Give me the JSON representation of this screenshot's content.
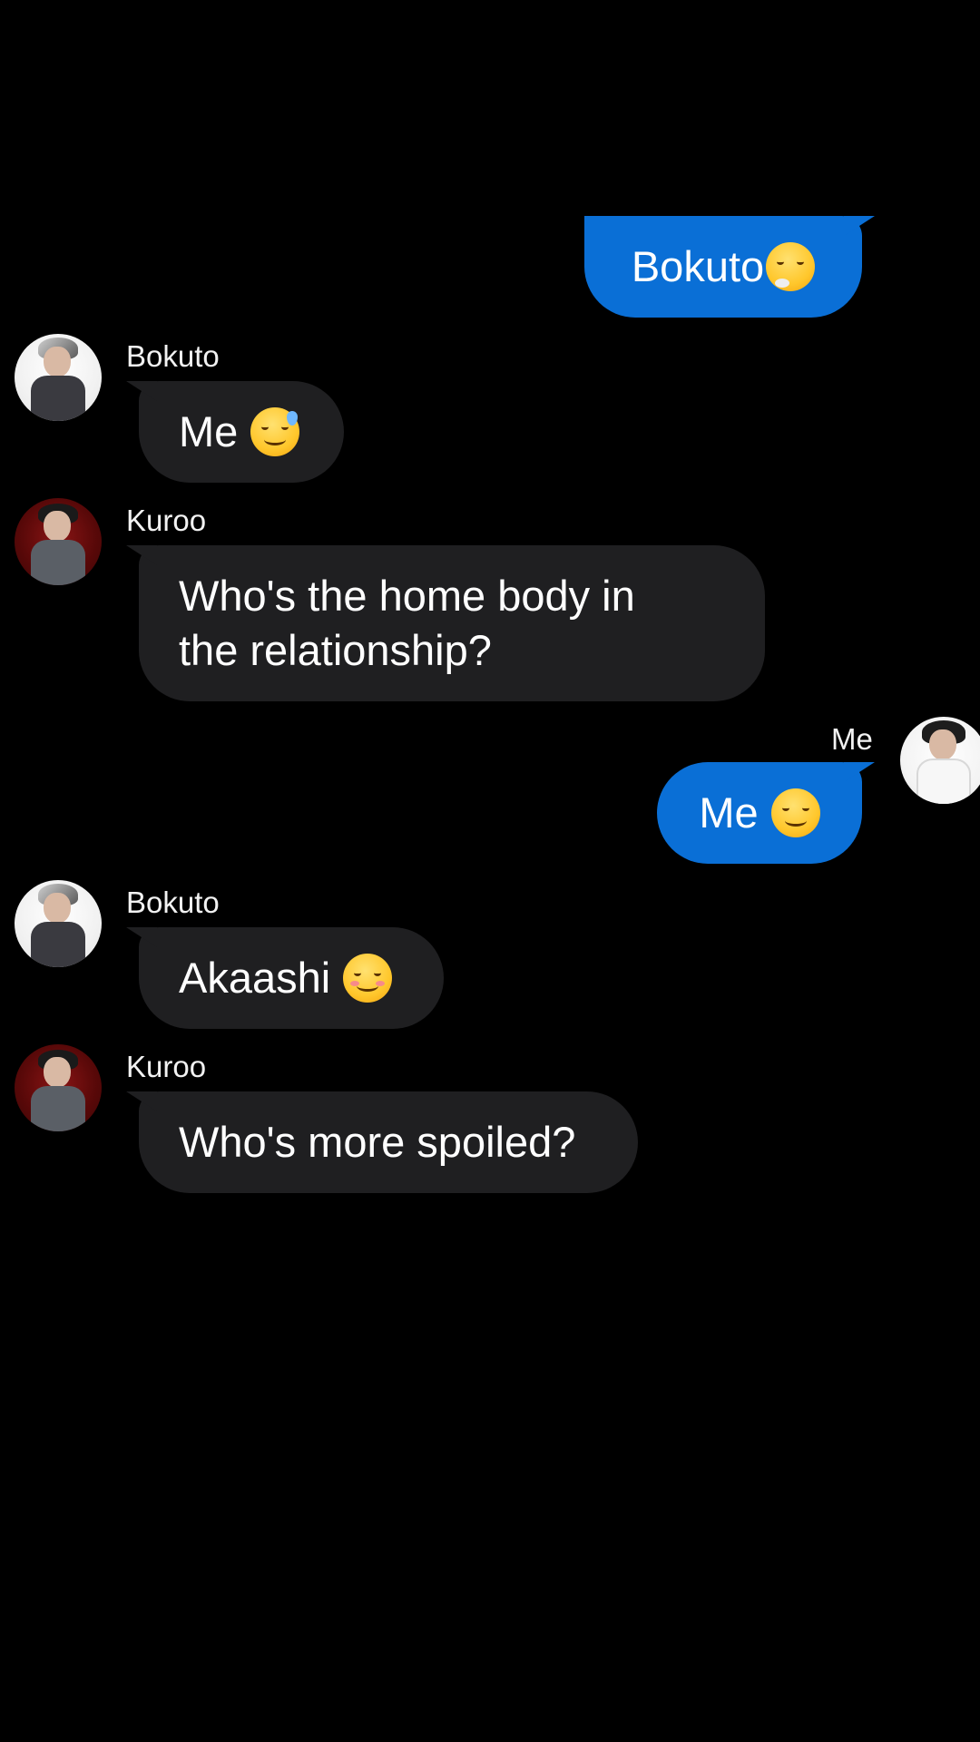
{
  "screen": {
    "background_color": "#000000",
    "incoming_bubble_color": "#1f1f21",
    "outgoing_bubble_color": "#0a6fd6"
  },
  "messages": [
    {
      "id": "m0",
      "direction": "out",
      "sender": "",
      "text": "Bokuto",
      "emoji": "exhaling-face-emoji"
    },
    {
      "id": "m1",
      "direction": "in",
      "sender": "Bokuto",
      "text": "Me",
      "emoji": "grinning-sweat-emoji"
    },
    {
      "id": "m2",
      "direction": "in",
      "sender": "Kuroo",
      "text_line1": "Who's the home body in",
      "text_line2": "the relationship?",
      "emoji": ""
    },
    {
      "id": "m3",
      "direction": "out",
      "sender": "Me",
      "text": "Me",
      "emoji": "relieved-face-emoji"
    },
    {
      "id": "m4",
      "direction": "in",
      "sender": "Bokuto",
      "text": "Akaashi",
      "emoji": "smiling-face-emoji"
    },
    {
      "id": "m5",
      "direction": "in",
      "sender": "Kuroo",
      "text": "Who's more spoiled?",
      "emoji": ""
    }
  ]
}
